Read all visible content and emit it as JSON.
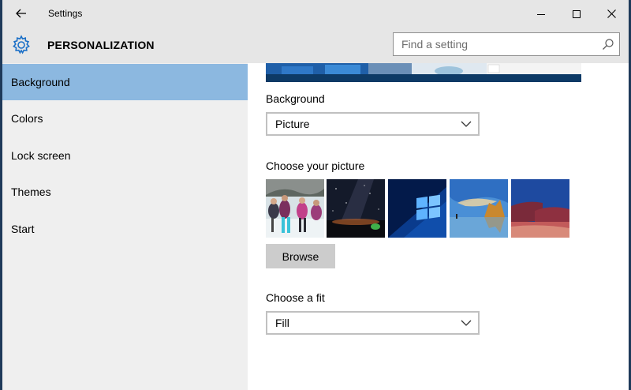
{
  "window": {
    "title": "Settings"
  },
  "header": {
    "title": "PERSONALIZATION"
  },
  "search": {
    "placeholder": "Find a setting"
  },
  "sidebar": {
    "items": [
      {
        "label": "Background",
        "active": true
      },
      {
        "label": "Colors"
      },
      {
        "label": "Lock screen"
      },
      {
        "label": "Themes"
      },
      {
        "label": "Start"
      }
    ]
  },
  "main": {
    "background_label": "Background",
    "background_value": "Picture",
    "choose_picture_label": "Choose your picture",
    "thumbnails": [
      {
        "name": "people-snow"
      },
      {
        "name": "night-sky-milky-way"
      },
      {
        "name": "windows-10-hero"
      },
      {
        "name": "beach-rocks-sunset"
      },
      {
        "name": "coastal-dusk"
      }
    ],
    "browse_label": "Browse",
    "fit_label": "Choose a fit",
    "fit_value": "Fill"
  },
  "colors": {
    "accent": "#8cb8e0",
    "chrome": "#e6e6e6",
    "sidebar_bg": "#efefef",
    "preview_taskbar": "#0d3a66"
  }
}
